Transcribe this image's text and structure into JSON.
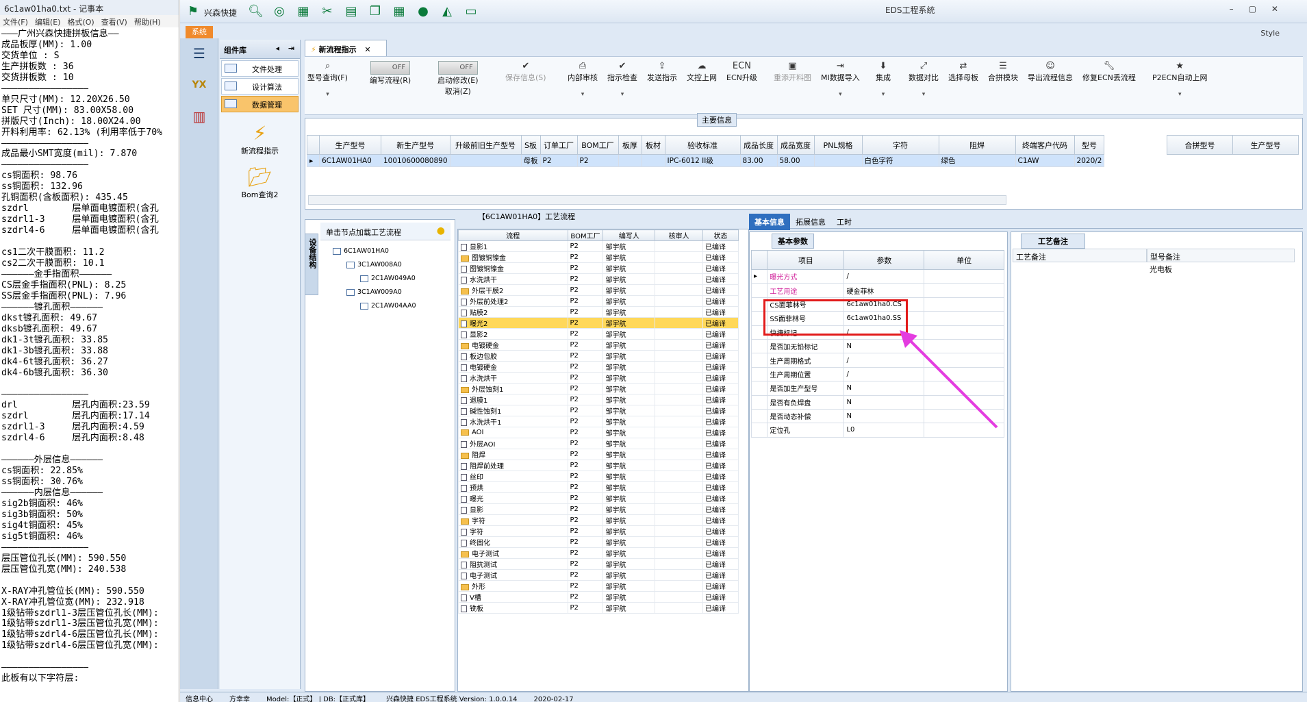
{
  "notepad": {
    "title": "6c1aw01ha0.txt - 记事本",
    "menu": [
      "文件(F)",
      "编辑(E)",
      "格式(O)",
      "查看(V)",
      "帮助(H)"
    ],
    "lines": [
      "———广州兴森快捷拼板信息——",
      "成品板厚(MM): 1.00",
      "交货单位 : S",
      "生产拼板数 : 36",
      "交货拼板数 : 10",
      "————————————————",
      "单只尺寸(MM): 12.20X26.50",
      "SET 尺寸(MM): 83.00X58.00",
      "拼版尺寸(Inch): 18.00X24.00",
      "开料利用率: 62.13% (利用率低于70%",
      "————————————————",
      "成品最小SMT宽度(mil): 7.870",
      "————————————————",
      "cs铜面积: 98.76",
      "ss铜面积: 132.96",
      "孔铜面积(含板面积): 435.45",
      "szdrl        层单面电镀面积(含孔",
      "szdrl1-3     层单面电镀面积(含孔",
      "szdrl4-6     层单面电镀面积(含孔",
      "",
      "cs1二次干膜面积: 11.2",
      "cs2二次干膜面积: 10.1",
      "——————金手指面积——————",
      "CS层金手指面积(PNL): 8.25",
      "SS层金手指面积(PNL): 7.96",
      "——————镀孔面积——————",
      "dkst镀孔面积: 49.67",
      "dksb镀孔面积: 49.67",
      "dk1-3t镀孔面积: 33.85",
      "dk1-3b镀孔面积: 33.88",
      "dk4-6t镀孔面积: 36.27",
      "dk4-6b镀孔面积: 36.30",
      "",
      "————————————————",
      "drl          层孔内面积:23.59",
      "szdrl        层孔内面积:17.14",
      "szdrl1-3     层孔内面积:4.59",
      "szdrl4-6     层孔内面积:8.48",
      "",
      "——————外层信息——————",
      "cs铜面积: 22.85%",
      "ss铜面积: 30.76%",
      "——————内层信息——————",
      "sig2b铜面积: 46%",
      "sig3b铜面积: 50%",
      "sig4t铜面积: 45%",
      "sig5t铜面积: 46%",
      "————————————————",
      "层压管位孔长(MM): 590.550",
      "层压管位孔宽(MM): 240.538",
      "",
      "X-RAY冲孔管位长(MM): 590.550",
      "X-RAY冲孔管位宽(MM): 232.918",
      "1级钻带szdrl1-3层压管位孔长(MM):",
      "1级钻带szdrl1-3层压管位孔宽(MM):",
      "1级钻带szdrl4-6层压管位孔长(MM):",
      "1级钻带szdrl4-6层压管位孔宽(MM):",
      "",
      "————————————————",
      "此板有以下字符层:"
    ]
  },
  "app": {
    "name": "兴森快捷",
    "window_title": "EDS工程系统",
    "style_label": "Style",
    "system_tab": "系统"
  },
  "library": {
    "title": "组件库",
    "items": [
      "文件处理",
      "设计算法",
      "数据管理"
    ],
    "selected_index": 2,
    "big_items": [
      "新流程指示",
      "Bom查询2"
    ]
  },
  "doc_tab": "新流程指示",
  "ribbon": [
    {
      "label": "型号查询(F)",
      "dd": true,
      "disabled": false
    },
    {
      "label": "编写流程(R)",
      "toggle": "OFF",
      "disabled": false
    },
    {
      "label": "启动修改(E)",
      "toggle": "OFF",
      "sub": "取消(Z)",
      "disabled": false
    },
    {
      "label": "保存信息(S)",
      "disabled": true
    },
    {
      "label": "内部审核",
      "dd": true,
      "disabled": false
    },
    {
      "label": "指示检查",
      "dd": true,
      "disabled": false
    },
    {
      "label": "发送指示",
      "disabled": false
    },
    {
      "label": "文控上网",
      "disabled": false
    },
    {
      "label": "ECN升级",
      "disabled": false
    },
    {
      "label": "重添开料图",
      "disabled": true
    },
    {
      "label": "MI数据导入",
      "dd": true,
      "disabled": false
    },
    {
      "label": "集成",
      "dd": true,
      "disabled": false
    },
    {
      "label": "数据对比",
      "dd": true,
      "disabled": false
    },
    {
      "label": "选择母板",
      "disabled": false
    },
    {
      "label": "合拼模块",
      "disabled": false
    },
    {
      "label": "导出流程信息",
      "disabled": false
    },
    {
      "label": "修复ECN丢流程",
      "disabled": false
    },
    {
      "label": "P2ECN自动上网",
      "dd": true,
      "disabled": false
    }
  ],
  "main_info": {
    "title": "主要信息",
    "columns": [
      "生产型号",
      "新生产型号",
      "升级前旧生产型号",
      "S板",
      "订单工厂",
      "BOM工厂",
      "板厚",
      "板材",
      "验收标准",
      "成品长度",
      "成品宽度",
      "PNL规格",
      "字符",
      "阻焊",
      "终端客户代码",
      "型号"
    ],
    "row": [
      "6C1AW01HA0",
      "10010600080890",
      "",
      "母板",
      "P2",
      "P2",
      "",
      "",
      "IPC-6012 II级",
      "83.00",
      "58.00",
      "",
      "白色字符",
      "绿色",
      "C1AW",
      "2020/2"
    ],
    "right_columns": [
      "合拼型号",
      "生产型号"
    ]
  },
  "process": {
    "header": "【6C1AW01HA0】工艺流程",
    "tree_tab": "设备结构",
    "tree_hint": "单击节点加载工艺流程",
    "tree": [
      {
        "label": "6C1AW01HA0",
        "level": 0
      },
      {
        "label": "3C1AW008A0",
        "level": 1
      },
      {
        "label": "2C1AW049A0",
        "level": 2
      },
      {
        "label": "3C1AW009A0",
        "level": 1
      },
      {
        "label": "2C1AW04AA0",
        "level": 2
      }
    ]
  },
  "flow": {
    "columns": [
      "流程",
      "BOM工厂",
      "编写人",
      "核审人",
      "状态"
    ],
    "rows": [
      {
        "name": "显影1",
        "level": 2,
        "f": "P2",
        "w": "邹宇航",
        "s": "已编译"
      },
      {
        "name": "图镀铜镍金",
        "level": 1,
        "f": "P2",
        "w": "邹宇航",
        "s": "已编译"
      },
      {
        "name": "图镀铜镍金",
        "level": 2,
        "f": "P2",
        "w": "邹宇航",
        "s": "已编译"
      },
      {
        "name": "水洗烘干",
        "level": 2,
        "f": "P2",
        "w": "邹宇航",
        "s": "已编译"
      },
      {
        "name": "外层干膜2",
        "level": 1,
        "f": "P2",
        "w": "邹宇航",
        "s": "已编译"
      },
      {
        "name": "外层前处理2",
        "level": 2,
        "f": "P2",
        "w": "邹宇航",
        "s": "已编译"
      },
      {
        "name": "贴膜2",
        "level": 2,
        "f": "P2",
        "w": "邹宇航",
        "s": "已编译"
      },
      {
        "name": "曝光2",
        "level": 2,
        "f": "P2",
        "w": "邹宇航",
        "s": "已编译",
        "hl": true
      },
      {
        "name": "显影2",
        "level": 2,
        "f": "P2",
        "w": "邹宇航",
        "s": "已编译"
      },
      {
        "name": "电镀硬金",
        "level": 1,
        "f": "P2",
        "w": "邹宇航",
        "s": "已编译"
      },
      {
        "name": "板边包胶",
        "level": 2,
        "f": "P2",
        "w": "邹宇航",
        "s": "已编译"
      },
      {
        "name": "电镀硬金",
        "level": 2,
        "f": "P2",
        "w": "邹宇航",
        "s": "已编译"
      },
      {
        "name": "水洗烘干",
        "level": 2,
        "f": "P2",
        "w": "邹宇航",
        "s": "已编译"
      },
      {
        "name": "外层蚀刻1",
        "level": 1,
        "f": "P2",
        "w": "邹宇航",
        "s": "已编译"
      },
      {
        "name": "退膜1",
        "level": 2,
        "f": "P2",
        "w": "邹宇航",
        "s": "已编译"
      },
      {
        "name": "碱性蚀刻1",
        "level": 2,
        "f": "P2",
        "w": "邹宇航",
        "s": "已编译"
      },
      {
        "name": "水洗烘干1",
        "level": 2,
        "f": "P2",
        "w": "邹宇航",
        "s": "已编译"
      },
      {
        "name": "AOI",
        "level": 1,
        "f": "P2",
        "w": "邹宇航",
        "s": "已编译"
      },
      {
        "name": "外层AOI",
        "level": 2,
        "f": "P2",
        "w": "邹宇航",
        "s": "已编译"
      },
      {
        "name": "阻焊",
        "level": 1,
        "f": "P2",
        "w": "邹宇航",
        "s": "已编译"
      },
      {
        "name": "阻焊前处理",
        "level": 2,
        "f": "P2",
        "w": "邹宇航",
        "s": "已编译"
      },
      {
        "name": "丝印",
        "level": 2,
        "f": "P2",
        "w": "邹宇航",
        "s": "已编译"
      },
      {
        "name": "预烘",
        "level": 2,
        "f": "P2",
        "w": "邹宇航",
        "s": "已编译"
      },
      {
        "name": "曝光",
        "level": 2,
        "f": "P2",
        "w": "邹宇航",
        "s": "已编译"
      },
      {
        "name": "显影",
        "level": 2,
        "f": "P2",
        "w": "邹宇航",
        "s": "已编译"
      },
      {
        "name": "字符",
        "level": 1,
        "f": "P2",
        "w": "邹宇航",
        "s": "已编译"
      },
      {
        "name": "字符",
        "level": 2,
        "f": "P2",
        "w": "邹宇航",
        "s": "已编译"
      },
      {
        "name": "终固化",
        "level": 2,
        "f": "P2",
        "w": "邹宇航",
        "s": "已编译"
      },
      {
        "name": "电子测试",
        "level": 1,
        "f": "P2",
        "w": "邹宇航",
        "s": "已编译"
      },
      {
        "name": "阻抗测试",
        "level": 2,
        "f": "P2",
        "w": "邹宇航",
        "s": "已编译"
      },
      {
        "name": "电子测试",
        "level": 2,
        "f": "P2",
        "w": "邹宇航",
        "s": "已编译"
      },
      {
        "name": "外形",
        "level": 1,
        "f": "P2",
        "w": "邹宇航",
        "s": "已编译"
      },
      {
        "name": "V槽",
        "level": 2,
        "f": "P2",
        "w": "邹宇航",
        "s": "已编译"
      },
      {
        "name": "铣板",
        "level": 2,
        "f": "P2",
        "w": "邹宇航",
        "s": "已编译"
      }
    ]
  },
  "basic": {
    "tabs": [
      "基本信息",
      "拓展信息",
      "工时"
    ],
    "sub_title": "基本参数",
    "columns": [
      "项目",
      "参数",
      "单位"
    ],
    "rows": [
      {
        "item": "曝光方式",
        "param": "/",
        "pink": true
      },
      {
        "item": "工艺用途",
        "param": "硬金菲林",
        "pink": true
      },
      {
        "item": "CS面菲林号",
        "param": "6c1aw01ha0.CS"
      },
      {
        "item": "SS面菲林号",
        "param": "6c1aw01ha0.SS"
      },
      {
        "item": "快捷标记",
        "param": "/"
      },
      {
        "item": "是否加无铅标记",
        "param": "N"
      },
      {
        "item": "生产周期格式",
        "param": "/"
      },
      {
        "item": "生产周期位置",
        "param": "/"
      },
      {
        "item": "是否加生产型号",
        "param": "N"
      },
      {
        "item": "是否有负焊盘",
        "param": "N"
      },
      {
        "item": "是否动态补偿",
        "param": "N"
      },
      {
        "item": "定位孔",
        "param": "L0"
      }
    ]
  },
  "craft": {
    "title": "工艺备注",
    "col1": "工艺备注",
    "col2": "型号备注",
    "value": "光电板"
  },
  "status": {
    "items": [
      "信息中心",
      "方幸幸",
      "Model:【正式】 | DB:【正式库】",
      "兴森快捷 EDS工程系统 Version: 1.0.0.14",
      "2020-02-17"
    ]
  },
  "colors": {
    "accent": "#2f6fbf",
    "highlight": "#ffd85a",
    "annotation_red": "#e21a1a",
    "annotation_arrow": "#e43ce0"
  }
}
